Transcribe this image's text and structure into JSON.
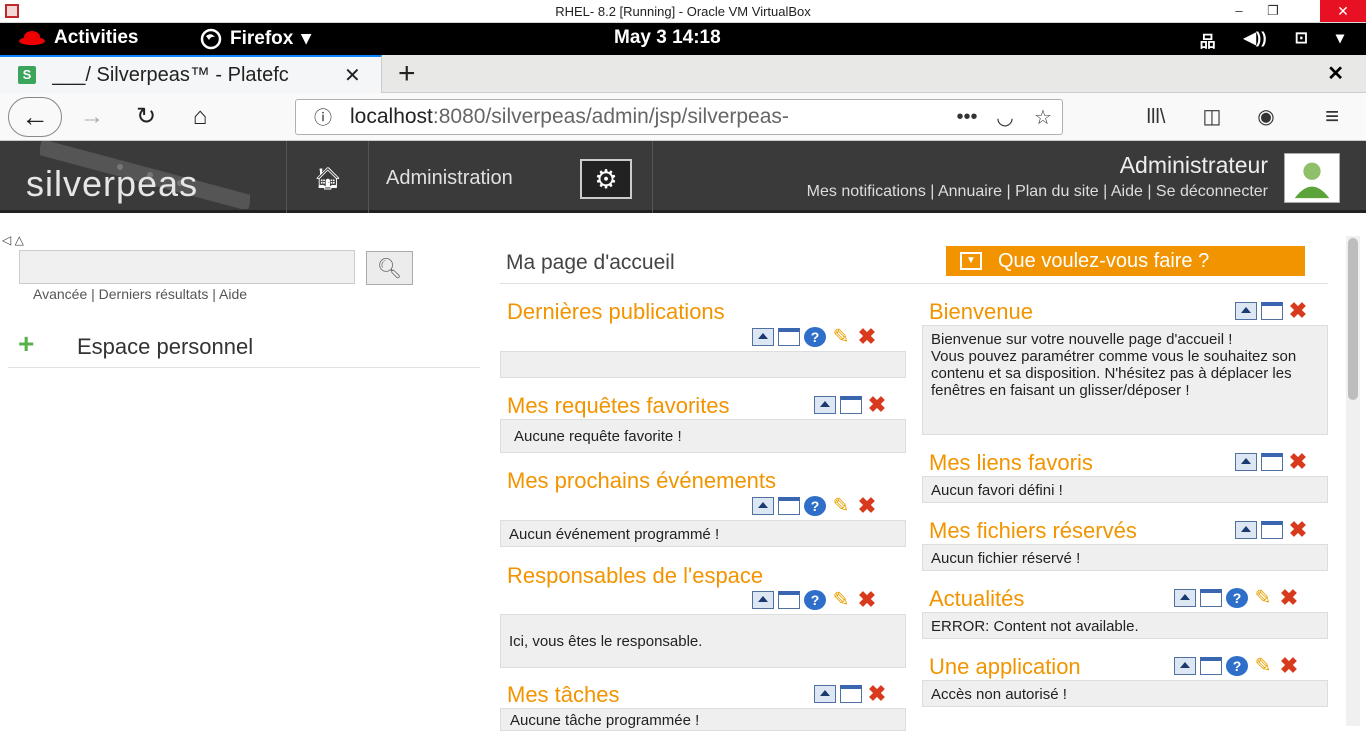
{
  "window": {
    "title": "RHEL- 8.2 [Running] - Oracle VM VirtualBox"
  },
  "gnome": {
    "activities": "Activities",
    "app_menu": "Firefox",
    "clock": "May 3  14:18"
  },
  "browser": {
    "tab_title": "___/ Silverpeas™ - Platefc",
    "tab_favicon": "S",
    "url_host": "localhost",
    "url_rest": ":8080/silverpeas/admin/jsp/silverpeas-",
    "page_actions": "•••"
  },
  "header": {
    "logo": "silverpeas",
    "admin_label": "Administration",
    "user_name": "Administrateur",
    "links": "Mes notifications | Annuaire | Plan du site | Aide | Se déconnecter"
  },
  "left": {
    "nav_arrows": "◁ △",
    "search_placeholder": "",
    "search_links": "Avancée | Derniers résultats | Aide",
    "espace_label": "Espace personnel"
  },
  "main": {
    "title": "Ma page d'accueil",
    "que_faire": "Que voulez-vous faire ?",
    "portlets": {
      "publications": {
        "title": "Dernières publications",
        "body": ""
      },
      "requetes": {
        "title": "Mes requêtes favorites",
        "body": "Aucune requête favorite !"
      },
      "evenements": {
        "title": "Mes prochains événements",
        "body": "Aucun événement programmé !"
      },
      "responsables": {
        "title": "Responsables de l'espace",
        "body": "Ici, vous êtes le responsable."
      },
      "taches": {
        "title": "Mes tâches",
        "body": "Aucune tâche programmée !"
      },
      "bienvenue": {
        "title": "Bienvenue",
        "body": "Bienvenue sur votre nouvelle page d'accueil !\nVous pouvez paramétrer comme vous le souhaitez son contenu et sa disposition. N'hésitez pas à déplacer les fenêtres en faisant un glisser/déposer !"
      },
      "liens": {
        "title": "Mes liens favoris",
        "body": "Aucun favori défini !"
      },
      "fichiers": {
        "title": "Mes fichiers réservés",
        "body": "Aucun fichier réservé !"
      },
      "actualites": {
        "title": "Actualités",
        "body": "ERROR: Content not available."
      },
      "application": {
        "title": "Une application",
        "body": "Accès non autorisé !"
      }
    }
  },
  "icons": {
    "gear": "gear-icon",
    "home": "home-icon",
    "search": "search-icon",
    "plus": "plus-icon",
    "minimize": "minimize-icon",
    "maximize": "maximize-icon",
    "help": "help-icon",
    "edit": "pencil-icon",
    "close": "close-icon"
  },
  "colors": {
    "accent": "#f29400",
    "header_bg": "#3a3a3a",
    "portlet_bg": "#efefef"
  }
}
